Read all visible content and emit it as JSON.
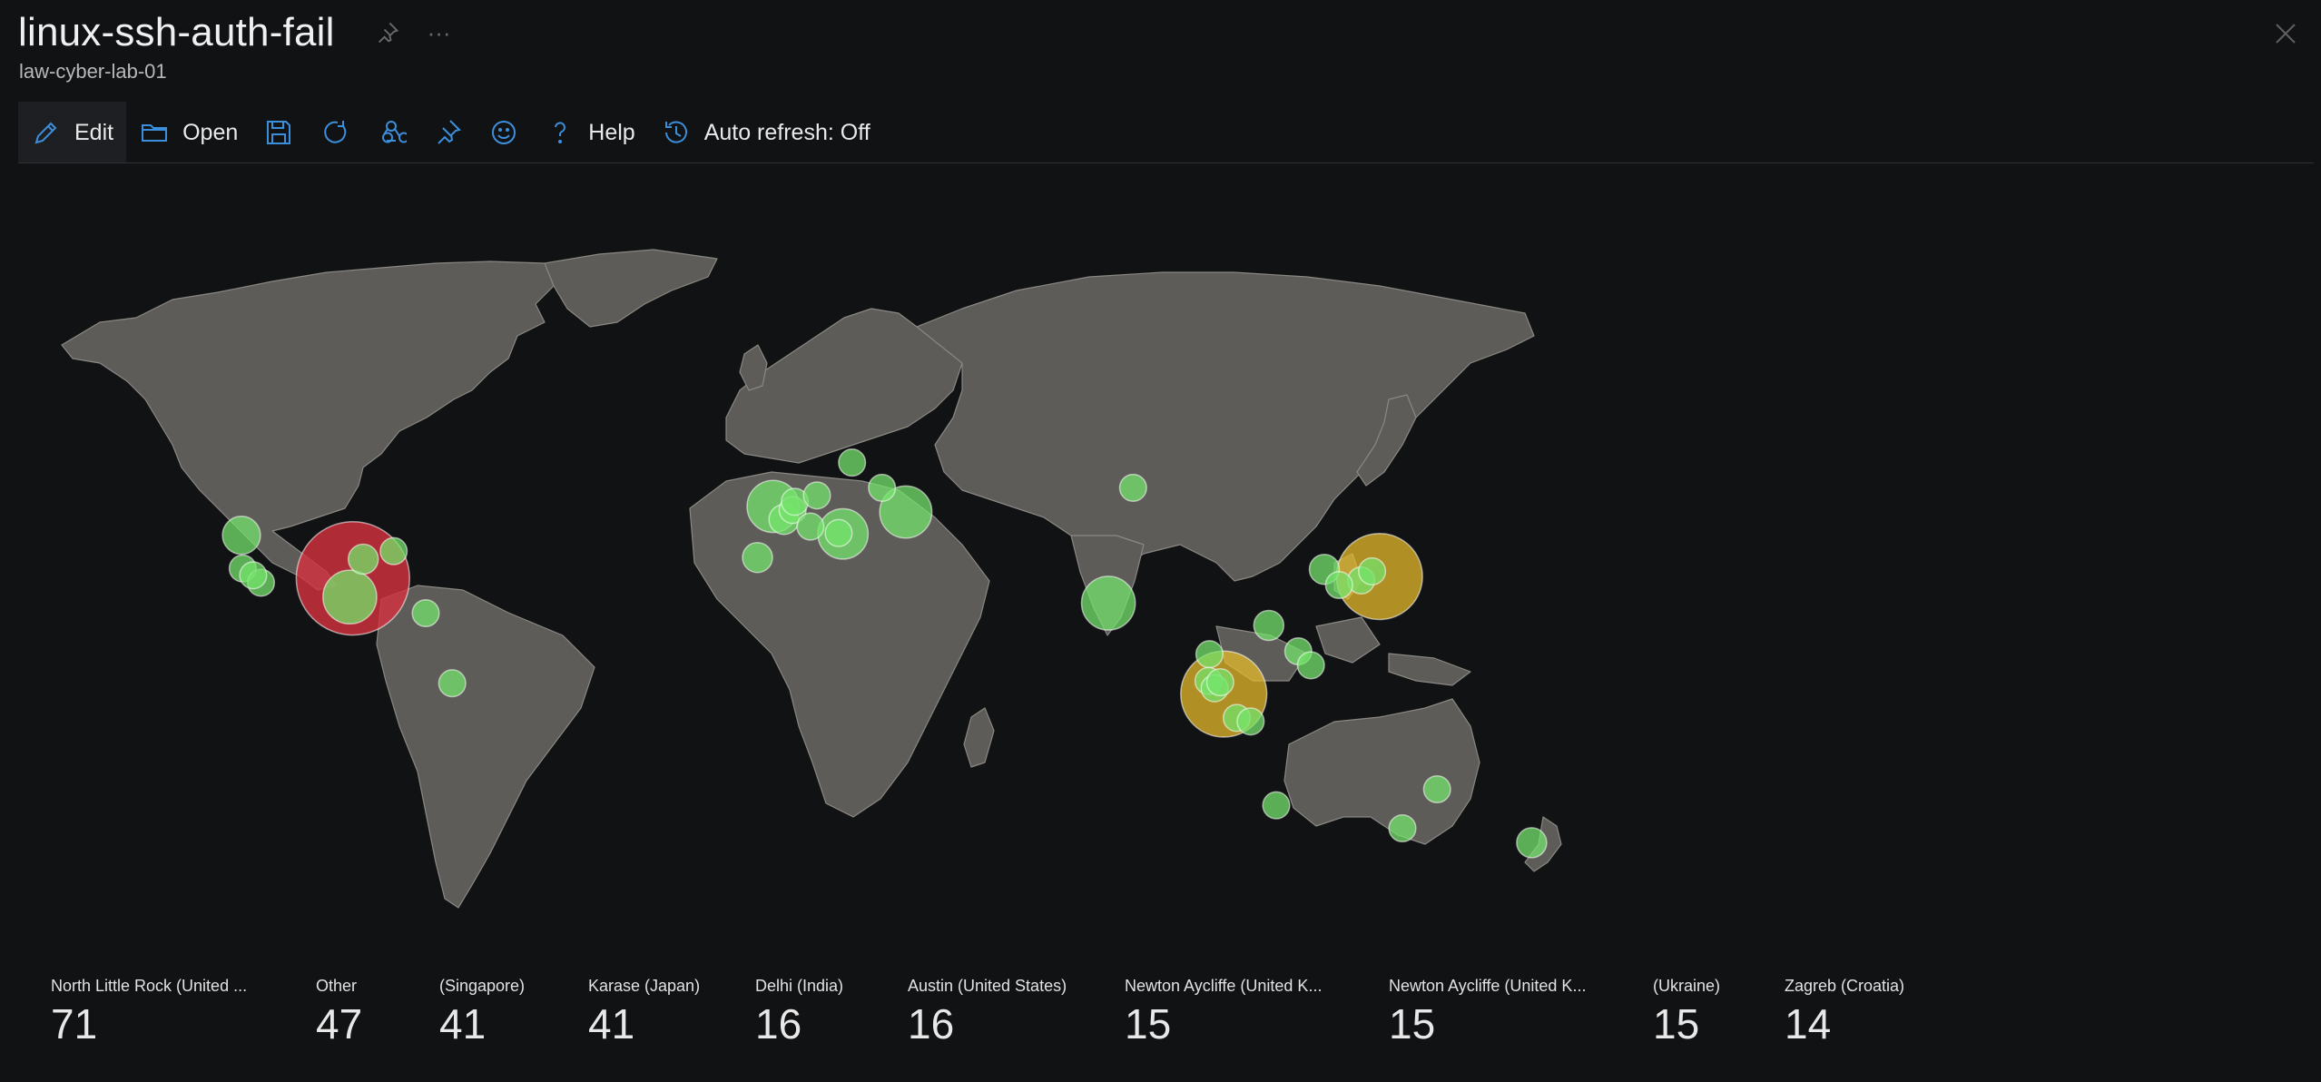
{
  "header": {
    "title": "linux-ssh-auth-fail",
    "subtitle": "law-cyber-lab-01",
    "more_glyph": "···"
  },
  "toolbar": {
    "edit_label": "Edit",
    "open_label": "Open",
    "help_label": "Help",
    "auto_refresh_label": "Auto refresh: Off"
  },
  "colors": {
    "accent": "#3b8fdc",
    "land": "#5e5c58",
    "bubble_low": "#74e36b",
    "bubble_mid": "#e6b92b",
    "bubble_high": "#d23240"
  },
  "map": {
    "type": "bubble-map",
    "bubbles": [
      {
        "lat": 35.2,
        "lon": -97.0,
        "count": 71,
        "level": "high"
      },
      {
        "lat": 1.3,
        "lon": 103.8,
        "count": 41,
        "level": "mid"
      },
      {
        "lat": 35.7,
        "lon": 139.7,
        "count": 41,
        "level": "mid"
      },
      {
        "lat": 51.5,
        "lon": -0.1,
        "count": 15,
        "level": "low"
      },
      {
        "lat": 28.6,
        "lon": 77.2,
        "count": 16,
        "level": "low"
      },
      {
        "lat": 30.3,
        "lon": -97.7,
        "count": 16,
        "level": "low"
      },
      {
        "lat": 50.4,
        "lon": 30.5,
        "count": 15,
        "level": "low"
      },
      {
        "lat": 45.8,
        "lon": 16.0,
        "count": 14,
        "level": "low"
      },
      {
        "lat": 45.5,
        "lon": -122.7,
        "count": 8,
        "level": "low"
      },
      {
        "lat": 37.7,
        "lon": -122.4,
        "count": 4,
        "level": "low"
      },
      {
        "lat": 34.1,
        "lon": -118.2,
        "count": 4,
        "level": "low"
      },
      {
        "lat": 36.0,
        "lon": -120.0,
        "count": 4,
        "level": "low"
      },
      {
        "lat": 41.9,
        "lon": -87.6,
        "count": 4,
        "level": "low"
      },
      {
        "lat": 40.0,
        "lon": -94.6,
        "count": 5,
        "level": "low"
      },
      {
        "lat": 25.8,
        "lon": -80.2,
        "count": 4,
        "level": "low"
      },
      {
        "lat": 4.7,
        "lon": -74.1,
        "count": 4,
        "level": "low"
      },
      {
        "lat": 40.4,
        "lon": -3.7,
        "count": 5,
        "level": "low"
      },
      {
        "lat": 48.9,
        "lon": 2.4,
        "count": 5,
        "level": "low"
      },
      {
        "lat": 50.8,
        "lon": 4.4,
        "count": 4,
        "level": "low"
      },
      {
        "lat": 52.4,
        "lon": 4.9,
        "count": 4,
        "level": "low"
      },
      {
        "lat": 53.6,
        "lon": 10.0,
        "count": 4,
        "level": "low"
      },
      {
        "lat": 47.4,
        "lon": 8.5,
        "count": 4,
        "level": "low"
      },
      {
        "lat": 46.0,
        "lon": 15.0,
        "count": 4,
        "level": "low"
      },
      {
        "lat": 59.3,
        "lon": 18.1,
        "count": 4,
        "level": "low"
      },
      {
        "lat": 55.0,
        "lon": 25.0,
        "count": 4,
        "level": "low"
      },
      {
        "lat": 55.0,
        "lon": 82.9,
        "count": 4,
        "level": "low"
      },
      {
        "lat": 37.5,
        "lon": 127.0,
        "count": 5,
        "level": "low"
      },
      {
        "lat": 22.3,
        "lon": 114.2,
        "count": 5,
        "level": "low"
      },
      {
        "lat": 34.7,
        "lon": 135.5,
        "count": 4,
        "level": "low"
      },
      {
        "lat": 37.0,
        "lon": 138.0,
        "count": 4,
        "level": "low"
      },
      {
        "lat": 33.5,
        "lon": 130.4,
        "count": 4,
        "level": "low"
      },
      {
        "lat": 13.7,
        "lon": 100.5,
        "count": 4,
        "level": "low"
      },
      {
        "lat": 14.6,
        "lon": 121.0,
        "count": 4,
        "level": "low"
      },
      {
        "lat": 10.3,
        "lon": 123.9,
        "count": 4,
        "level": "low"
      },
      {
        "lat": 5.4,
        "lon": 100.3,
        "count": 4,
        "level": "low"
      },
      {
        "lat": 3.1,
        "lon": 101.7,
        "count": 4,
        "level": "low"
      },
      {
        "lat": 5.0,
        "lon": 103.0,
        "count": 4,
        "level": "low"
      },
      {
        "lat": -6.2,
        "lon": 106.8,
        "count": 4,
        "level": "low"
      },
      {
        "lat": -7.3,
        "lon": 110.0,
        "count": 4,
        "level": "low"
      },
      {
        "lat": -31.9,
        "lon": 115.9,
        "count": 4,
        "level": "low"
      },
      {
        "lat": -37.8,
        "lon": 145.0,
        "count": 4,
        "level": "low"
      },
      {
        "lat": -27.5,
        "lon": 153.0,
        "count": 4,
        "level": "low"
      },
      {
        "lat": -41.3,
        "lon": 174.8,
        "count": 5,
        "level": "low"
      }
    ]
  },
  "legend": [
    {
      "label": "North Little Rock (United ...",
      "value": "71"
    },
    {
      "label": "Other",
      "value": "47"
    },
    {
      "label": "(Singapore)",
      "value": "41"
    },
    {
      "label": "Karase (Japan)",
      "value": "41"
    },
    {
      "label": "Delhi (India)",
      "value": "16"
    },
    {
      "label": "Austin (United States)",
      "value": "16"
    },
    {
      "label": "Newton Aycliffe (United K...",
      "value": "15"
    },
    {
      "label": "Newton Aycliffe (United K...",
      "value": "15"
    },
    {
      "label": "(Ukraine)",
      "value": "15"
    },
    {
      "label": "Zagreb (Croatia)",
      "value": "14"
    }
  ]
}
